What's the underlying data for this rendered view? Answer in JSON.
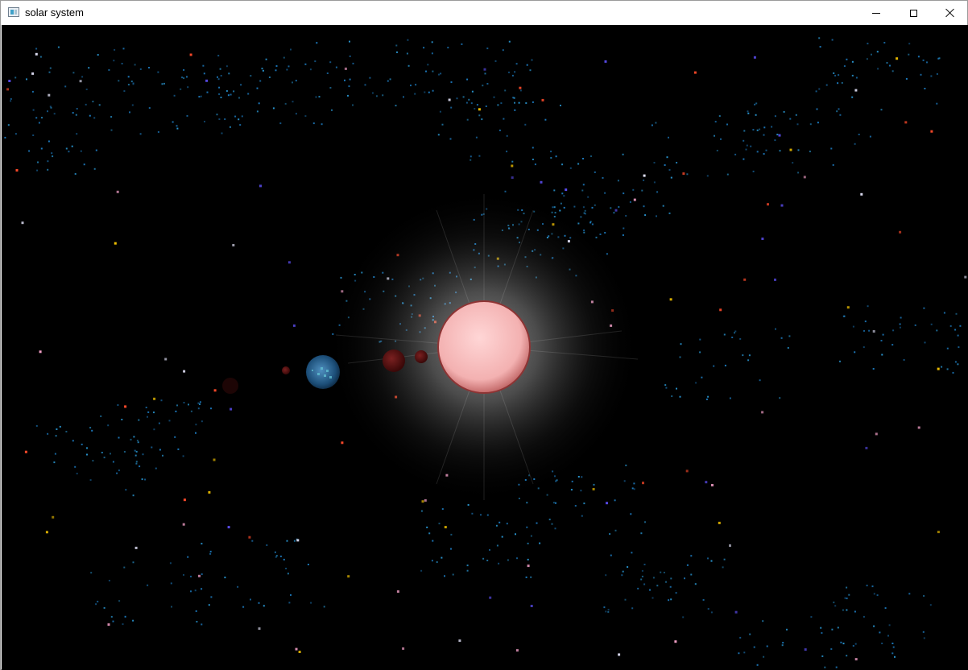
{
  "window": {
    "title": "solar system",
    "app_icon": "app-window-icon",
    "controls": {
      "minimize_icon": "minimize-icon",
      "maximize_icon": "maximize-icon",
      "close_icon": "close-icon"
    }
  },
  "scene": {
    "background_color": "#000000",
    "sun": {
      "color": "#f3b7b7",
      "rim_color": "#9a3a3a",
      "glow_color": "#ffffff"
    },
    "planets": [
      {
        "name": "planet-near-sun-small",
        "color": "#4a0d0d"
      },
      {
        "name": "planet-red",
        "color": "#5a1212"
      },
      {
        "name": "planet-earth",
        "color": "#1c4e78"
      },
      {
        "name": "planet-tiny",
        "color": "#6a1a1a"
      },
      {
        "name": "planet-far-faint",
        "color": "#2a0707"
      }
    ],
    "star_colors": [
      "#1e7fc6",
      "#2a9bd8",
      "#5b4df0",
      "#f2c200",
      "#f4a0c8",
      "#ff4a2a",
      "#e8e8ff"
    ]
  }
}
